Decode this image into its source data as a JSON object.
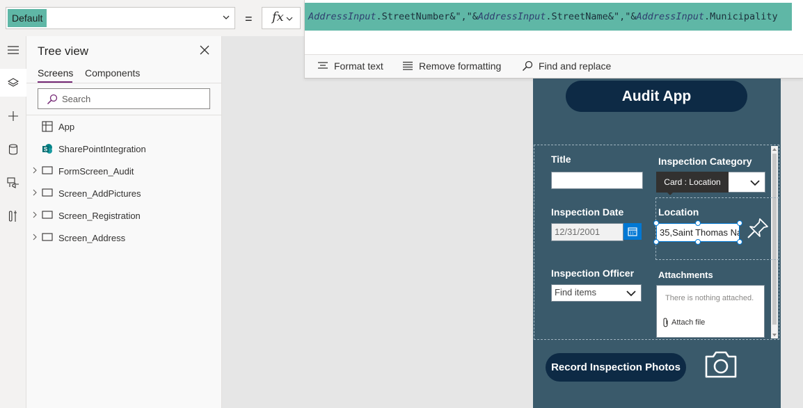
{
  "formula_bar": {
    "property_value": "Default",
    "equals": "=",
    "fx_label": "fx",
    "formula_segments": [
      {
        "text": "AddressInput",
        "ident": true
      },
      {
        "text": ".StreetNumber&\",\"&",
        "ident": false
      },
      {
        "text": "AddressInput",
        "ident": true
      },
      {
        "text": ".StreetName&\",\"&",
        "ident": false
      },
      {
        "text": "AddressInput",
        "ident": true
      },
      {
        "text": ".Municipality",
        "ident": false
      }
    ],
    "toolbar": {
      "format_text": "Format text",
      "remove_formatting": "Remove formatting",
      "find_replace": "Find and replace"
    }
  },
  "rail": {
    "icons": [
      "hamburger-icon",
      "layers-icon",
      "plus-icon",
      "database-icon",
      "media-icon",
      "tools-icon"
    ]
  },
  "tree": {
    "title": "Tree view",
    "tabs": [
      "Screens",
      "Components"
    ],
    "active_tab": "Screens",
    "search_placeholder": "Search",
    "items": [
      {
        "label": "App",
        "icon": "app-icon",
        "expandable": false
      },
      {
        "label": "SharePointIntegration",
        "icon": "sharepoint-icon",
        "expandable": false
      },
      {
        "label": "FormScreen_Audit",
        "icon": "screen-icon",
        "expandable": true
      },
      {
        "label": "Screen_AddPictures",
        "icon": "screen-icon",
        "expandable": true
      },
      {
        "label": "Screen_Registration",
        "icon": "screen-icon",
        "expandable": true
      },
      {
        "label": "Screen_Address",
        "icon": "screen-icon",
        "expandable": true
      }
    ]
  },
  "app_screen": {
    "title": "Audit App",
    "fields": {
      "title_label": "Title",
      "category_label": "Inspection Category",
      "date_label": "Inspection Date",
      "date_value": "12/31/2001",
      "location_label": "Location",
      "location_value": "35,Saint Thomas Na",
      "officer_label": "Inspection Officer",
      "officer_placeholder": "Find items",
      "attachments_label": "Attachments",
      "attachments_empty": "There is nothing attached.",
      "attach_file": "Attach file"
    },
    "tooltip": "Card : Location",
    "photo_button": "Record Inspection Photos"
  },
  "colors": {
    "highlight": "#5fb7a6",
    "screen_bg": "#3a5a6b",
    "button_bg": "#0d2a45",
    "accent": "#742774",
    "selection": "#0078d4"
  }
}
